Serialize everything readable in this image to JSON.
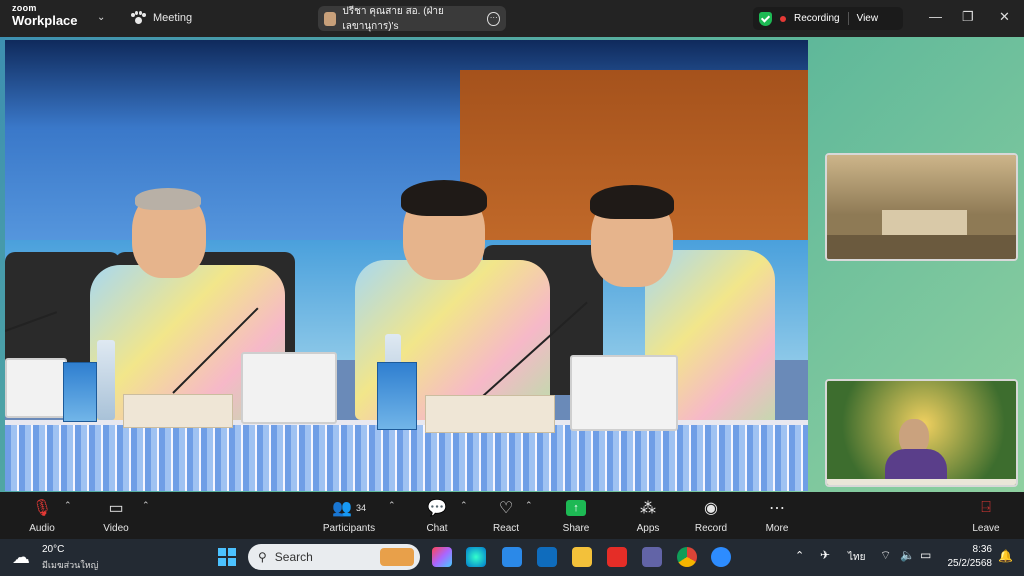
{
  "titlebar": {
    "brand_small": "zoom",
    "brand_large": "Workplace",
    "meeting_label": "Meeting",
    "active_speaker": "ปรีชา คุณสาย สอ. (ฝ่ายเลขานุการ)'s",
    "recording_label": "Recording",
    "view_label": "View"
  },
  "toolbar": {
    "audio_label": "Audio",
    "video_label": "Video",
    "participants_label": "Participants",
    "participants_count": "34",
    "chat_label": "Chat",
    "react_label": "React",
    "share_label": "Share",
    "apps_label": "Apps",
    "record_label": "Record",
    "more_label": "More",
    "leave_label": "Leave"
  },
  "taskbar": {
    "weather_temp": "20°C",
    "weather_desc": "มีเมฆส่วนใหญ่",
    "search_placeholder": "Search",
    "language": "ไทย",
    "time": "8:36",
    "date": "25/2/2568"
  },
  "colors": {
    "accent_green": "#1db954",
    "recording_red": "#e53935",
    "leave_red": "#e53935"
  }
}
